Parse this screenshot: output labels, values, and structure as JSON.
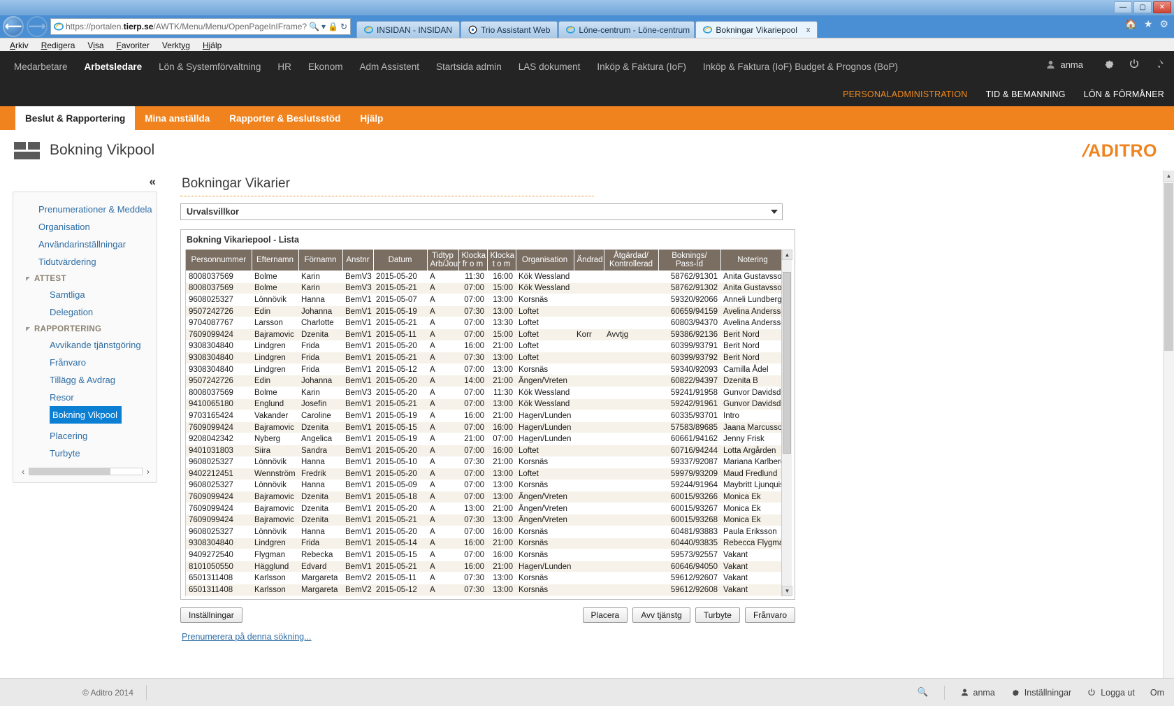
{
  "browser": {
    "url_prefix": "https://",
    "url_domain_pre": "portalen.",
    "url_domain": "tierp.se",
    "url_path": "/AWTK/Menu/Menu/OpenPageInIFrame?iFrar",
    "window_buttons": {
      "minimize": "—",
      "maximize": "▢",
      "close": "✕"
    },
    "tabs": [
      {
        "label": "INSIDAN - INSIDAN",
        "active": false,
        "icon": "ie-icon"
      },
      {
        "label": "Trio Assistant Web",
        "active": false,
        "icon": "trio-icon"
      },
      {
        "label": "Löne-centrum - Löne-centrum",
        "active": false,
        "icon": "ie-icon"
      },
      {
        "label": "Bokningar Vikariepool",
        "active": true,
        "icon": "ie-icon",
        "close": "x"
      }
    ],
    "menu": [
      "Arkiv",
      "Redigera",
      "Visa",
      "Favoriter",
      "Verktyg",
      "Hjälp"
    ],
    "menu_accel": [
      "A",
      "R",
      "V",
      "F",
      "V",
      "H"
    ]
  },
  "topnav": {
    "items": [
      {
        "label": "Medarbetare",
        "active": false
      },
      {
        "label": "Arbetsledare",
        "active": true
      },
      {
        "label": "Lön & Systemförvaltning",
        "active": false
      },
      {
        "label": "HR",
        "active": false
      },
      {
        "label": "Ekonom",
        "active": false
      },
      {
        "label": "Adm Assistent",
        "active": false
      },
      {
        "label": "Startsida admin",
        "active": false
      },
      {
        "label": "LAS dokument",
        "active": false
      },
      {
        "label": "Inköp & Faktura (IoF)",
        "active": false
      },
      {
        "label": "Inköp & Faktura (IoF) Budget & Prognos (BoP)",
        "active": false
      }
    ],
    "user": "anma"
  },
  "subnav": {
    "items": [
      {
        "label": "PERSONALADMINISTRATION",
        "current": true
      },
      {
        "label": "TID & BEMANNING",
        "current": false
      },
      {
        "label": "LÖN & FÖRMÅNER",
        "current": false
      }
    ]
  },
  "orangebar": {
    "items": [
      {
        "label": "Beslut & Rapportering",
        "active": true
      },
      {
        "label": "Mina anställda",
        "active": false
      },
      {
        "label": "Rapporter & Beslutsstöd",
        "active": false
      },
      {
        "label": "Hjälp",
        "active": false
      }
    ]
  },
  "appheader": {
    "title": "Bokning Vikpool",
    "brand": "ADITRO"
  },
  "sidebar": {
    "collapse_icon": "«",
    "items": [
      {
        "label": "Prenumerationer & Meddela",
        "type": "link"
      },
      {
        "label": "Organisation",
        "type": "link"
      },
      {
        "label": "Användarinställningar",
        "type": "link"
      },
      {
        "label": "Tidutvärdering",
        "type": "link"
      },
      {
        "label": "ATTEST",
        "type": "group"
      },
      {
        "label": "Samtliga",
        "type": "sub"
      },
      {
        "label": "Delegation",
        "type": "sub"
      },
      {
        "label": "RAPPORTERING",
        "type": "group"
      },
      {
        "label": "Avvikande tjänstgöring",
        "type": "sub"
      },
      {
        "label": "Frånvaro",
        "type": "sub"
      },
      {
        "label": "Tillägg & Avdrag",
        "type": "sub"
      },
      {
        "label": "Resor",
        "type": "sub"
      },
      {
        "label": "Bokning Vikpool",
        "type": "sub",
        "selected": true
      },
      {
        "label": "Placering",
        "type": "sub"
      },
      {
        "label": "Turbyte",
        "type": "sub"
      }
    ]
  },
  "main": {
    "page_title": "Bokningar Vikarier",
    "selector_label": "Urvalsvillkor",
    "list_title": "Bokning Vikariepool - Lista",
    "columns": [
      "Personnummer",
      "Efternamn",
      "Förnamn",
      "Anstnr",
      "Datum",
      "Tidtyp Arb/Jour",
      "Klocka fr o m",
      "Klocka t o m",
      "Organisation",
      "Ändrad",
      "Åtgärdad/ Kontrollerad",
      "Boknings/ Pass-Id",
      "Notering"
    ],
    "columns_lines": [
      [
        "Personnummer"
      ],
      [
        "Efternamn"
      ],
      [
        "Förnamn"
      ],
      [
        "Anstnr"
      ],
      [
        "Datum"
      ],
      [
        "Tidtyp",
        "Arb/Jour"
      ],
      [
        "Klocka",
        "fr o m"
      ],
      [
        "Klocka",
        "t o m"
      ],
      [
        "Organisation"
      ],
      [
        "Ändrad"
      ],
      [
        "Åtgärdad/",
        "Kontrollerad"
      ],
      [
        "Boknings/",
        "Pass-Id"
      ],
      [
        "Notering"
      ]
    ],
    "rows": [
      [
        "8008037569",
        "Bolme",
        "Karin",
        "BemV3",
        "2015-05-20",
        "A",
        "11:30",
        "16:00",
        "Kök Wessland",
        "",
        "",
        "58762/91301",
        "Anita Gustavsson"
      ],
      [
        "8008037569",
        "Bolme",
        "Karin",
        "BemV3",
        "2015-05-21",
        "A",
        "07:00",
        "15:00",
        "Kök Wessland",
        "",
        "",
        "58762/91302",
        "Anita Gustavsson"
      ],
      [
        "9608025327",
        "Lönnövik",
        "Hanna",
        "BemV1",
        "2015-05-07",
        "A",
        "07:00",
        "13:00",
        "Korsnäs",
        "",
        "",
        "59320/92066",
        "Anneli Lundberg"
      ],
      [
        "9507242726",
        "Edin",
        "Johanna",
        "BemV1",
        "2015-05-19",
        "A",
        "07:30",
        "13:00",
        "Loftet",
        "",
        "",
        "60659/94159",
        "Avelina Andersson"
      ],
      [
        "9704087767",
        "Larsson",
        "Charlotte",
        "BemV1",
        "2015-05-21",
        "A",
        "07:00",
        "13:30",
        "Loftet",
        "",
        "",
        "60803/94370",
        "Avelina Andersson"
      ],
      [
        "7609099424",
        "Bajramovic",
        "Dzenita",
        "BemV1",
        "2015-05-11",
        "A",
        "07:00",
        "15:00",
        "Loftet",
        "Korr",
        "Avvtjg",
        "59386/92136",
        "Berit Nord"
      ],
      [
        "9308304840",
        "Lindgren",
        "Frida",
        "BemV1",
        "2015-05-20",
        "A",
        "16:00",
        "21:00",
        "Loftet",
        "",
        "",
        "60399/93791",
        "Berit Nord"
      ],
      [
        "9308304840",
        "Lindgren",
        "Frida",
        "BemV1",
        "2015-05-21",
        "A",
        "07:30",
        "13:00",
        "Loftet",
        "",
        "",
        "60399/93792",
        "Berit Nord"
      ],
      [
        "9308304840",
        "Lindgren",
        "Frida",
        "BemV1",
        "2015-05-12",
        "A",
        "07:00",
        "13:00",
        "Korsnäs",
        "",
        "",
        "59340/92093",
        "Camilla Ådel"
      ],
      [
        "9507242726",
        "Edin",
        "Johanna",
        "BemV1",
        "2015-05-20",
        "A",
        "14:00",
        "21:00",
        "Ängen/Vreten",
        "",
        "",
        "60822/94397",
        "Dzenita B"
      ],
      [
        "8008037569",
        "Bolme",
        "Karin",
        "BemV3",
        "2015-05-20",
        "A",
        "07:00",
        "11:30",
        "Kök Wessland",
        "",
        "",
        "59241/91958",
        "Gunvor Davidsdotter"
      ],
      [
        "9410065180",
        "Englund",
        "Josefin",
        "BemV1",
        "2015-05-21",
        "A",
        "07:00",
        "13:00",
        "Kök Wessland",
        "",
        "",
        "59242/91961",
        "Gunvor Davidsdotter"
      ],
      [
        "9703165424",
        "Vakander",
        "Caroline",
        "BemV1",
        "2015-05-19",
        "A",
        "16:00",
        "21:00",
        "Hagen/Lunden",
        "",
        "",
        "60335/93701",
        "Intro"
      ],
      [
        "7609099424",
        "Bajramovic",
        "Dzenita",
        "BemV1",
        "2015-05-15",
        "A",
        "07:00",
        "16:00",
        "Hagen/Lunden",
        "",
        "",
        "57583/89685",
        "Jaana Marcusson"
      ],
      [
        "9208042342",
        "Nyberg",
        "Angelica",
        "BemV1",
        "2015-05-19",
        "A",
        "21:00",
        "07:00",
        "Hagen/Lunden",
        "",
        "",
        "60661/94162",
        "Jenny Frisk"
      ],
      [
        "9401031803",
        "Siira",
        "Sandra",
        "BemV1",
        "2015-05-20",
        "A",
        "07:00",
        "16:00",
        "Loftet",
        "",
        "",
        "60716/94244",
        "Lotta Argården"
      ],
      [
        "9608025327",
        "Lönnövik",
        "Hanna",
        "BemV1",
        "2015-05-10",
        "A",
        "07:30",
        "21:00",
        "Korsnäs",
        "",
        "",
        "59337/92087",
        "Mariana Karlberg"
      ],
      [
        "9402212451",
        "Wennström",
        "Fredrik",
        "BemV1",
        "2015-05-20",
        "A",
        "07:00",
        "13:00",
        "Loftet",
        "",
        "",
        "59979/93209",
        "Maud Fredlund"
      ],
      [
        "9608025327",
        "Lönnövik",
        "Hanna",
        "BemV1",
        "2015-05-09",
        "A",
        "07:00",
        "13:00",
        "Korsnäs",
        "",
        "",
        "59244/91964",
        "Maybritt Ljunquist"
      ],
      [
        "7609099424",
        "Bajramovic",
        "Dzenita",
        "BemV1",
        "2015-05-18",
        "A",
        "07:00",
        "13:00",
        "Ängen/Vreten",
        "",
        "",
        "60015/93266",
        "Monica Ek"
      ],
      [
        "7609099424",
        "Bajramovic",
        "Dzenita",
        "BemV1",
        "2015-05-20",
        "A",
        "13:00",
        "21:00",
        "Ängen/Vreten",
        "",
        "",
        "60015/93267",
        "Monica Ek"
      ],
      [
        "7609099424",
        "Bajramovic",
        "Dzenita",
        "BemV1",
        "2015-05-21",
        "A",
        "07:30",
        "13:00",
        "Ängen/Vreten",
        "",
        "",
        "60015/93268",
        "Monica Ek"
      ],
      [
        "9608025327",
        "Lönnövik",
        "Hanna",
        "BemV1",
        "2015-05-20",
        "A",
        "07:00",
        "16:00",
        "Korsnäs",
        "",
        "",
        "60481/93883",
        "Paula Eriksson"
      ],
      [
        "9308304840",
        "Lindgren",
        "Frida",
        "BemV1",
        "2015-05-14",
        "A",
        "16:00",
        "21:00",
        "Korsnäs",
        "",
        "",
        "60440/93835",
        "Rebecca Flygman"
      ],
      [
        "9409272540",
        "Flygman",
        "Rebecka",
        "BemV1",
        "2015-05-15",
        "A",
        "07:00",
        "16:00",
        "Korsnäs",
        "",
        "",
        "59573/92557",
        "Vakant"
      ],
      [
        "8101050550",
        "Hägglund",
        "Edvard",
        "BemV1",
        "2015-05-21",
        "A",
        "16:00",
        "21:00",
        "Hagen/Lunden",
        "",
        "",
        "60646/94050",
        "Vakant"
      ],
      [
        "6501311408",
        "Karlsson",
        "Margareta",
        "BemV2",
        "2015-05-11",
        "A",
        "07:30",
        "13:00",
        "Korsnäs",
        "",
        "",
        "59612/92607",
        "Vakant"
      ],
      [
        "6501311408",
        "Karlsson",
        "Margareta",
        "BemV2",
        "2015-05-12",
        "A",
        "07:30",
        "13:00",
        "Korsnäs",
        "",
        "",
        "59612/92608",
        "Vakant"
      ]
    ],
    "buttons": {
      "settings": "Inställningar",
      "placera": "Placera",
      "avv_tjanstg": "Avv tjänstg",
      "turbyte": "Turbyte",
      "franvaro": "Frånvaro"
    },
    "subscribe_link": "Prenumerera på denna sökning..."
  },
  "footer": {
    "copyright": "© Aditro 2014",
    "user": "anma",
    "settings": "Inställningar",
    "logout": "Logga ut",
    "about": "Om"
  },
  "colors": {
    "orange": "#f0831e",
    "dark": "#242424",
    "table_header": "#7a6e63",
    "selected_blue": "#0b7fd4",
    "link_blue": "#2e6da4"
  }
}
